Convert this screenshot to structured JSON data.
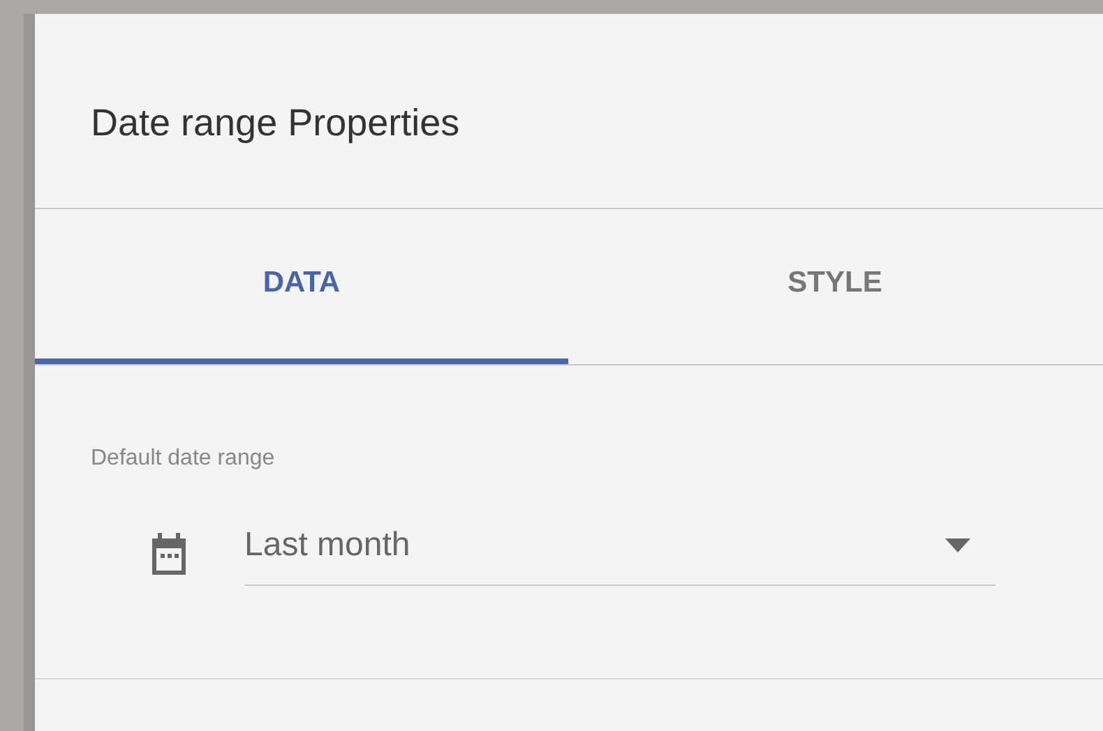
{
  "panel": {
    "title": "Date range Properties"
  },
  "tabs": [
    {
      "label": "DATA",
      "selected": true
    },
    {
      "label": "STYLE",
      "selected": false
    }
  ],
  "field": {
    "label": "Default date range",
    "value": "Last month"
  }
}
